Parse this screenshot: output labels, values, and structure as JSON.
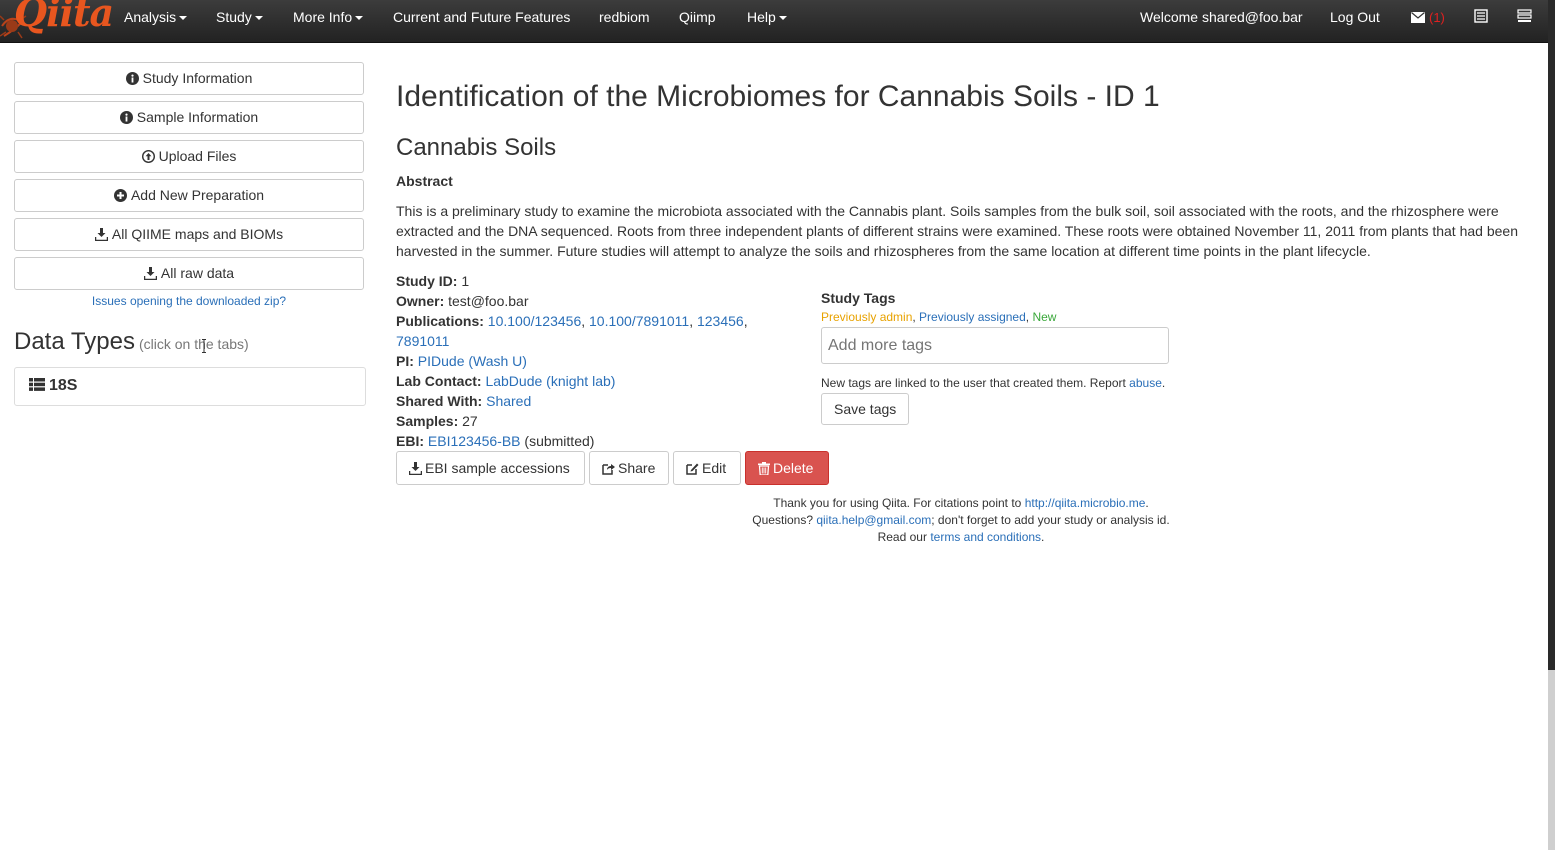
{
  "nav": {
    "items": [
      {
        "label": "Analysis",
        "dropdown": true
      },
      {
        "label": "Study",
        "dropdown": true
      },
      {
        "label": "More Info",
        "dropdown": true
      },
      {
        "label": "Current and Future Features",
        "dropdown": false
      },
      {
        "label": "redbiom",
        "dropdown": false
      },
      {
        "label": "Qiimp",
        "dropdown": false
      },
      {
        "label": "Help",
        "dropdown": true
      }
    ],
    "welcome": "Welcome shared@foo.bar",
    "logout": "Log Out",
    "mail_count": "(1)",
    "logo_text": "Qiita"
  },
  "sidebar": {
    "buttons": [
      {
        "label": "Study Information",
        "icon": "info-circle-icon"
      },
      {
        "label": "Sample Information",
        "icon": "info-circle-icon"
      },
      {
        "label": "Upload Files",
        "icon": "upload-circle-icon"
      },
      {
        "label": "Add New Preparation",
        "icon": "plus-circle-icon"
      },
      {
        "label": "All QIIME maps and BIOMs",
        "icon": "download-icon"
      },
      {
        "label": "All raw data",
        "icon": "download-icon"
      }
    ],
    "issues_link": "Issues opening the downloaded zip?",
    "data_types_title": "Data Types",
    "data_types_hint": "(click on the tabs)",
    "data_type_tab": "18S"
  },
  "study": {
    "title": "Identification of the Microbiomes for Cannabis Soils - ID 1",
    "alias": "Cannabis Soils",
    "abstract_label": "Abstract",
    "abstract": "This is a preliminary study to examine the microbiota associated with the Cannabis plant. Soils samples from the bulk soil, soil associated with the roots, and the rhizosphere were extracted and the DNA sequenced. Roots from three independent plants of different strains were examined. These roots were obtained November 11, 2011 from plants that had been harvested in the summer. Future studies will attempt to analyze the soils and rhizospheres from the same location at different time points in the plant lifecycle.",
    "id_label": "Study ID:",
    "id_value": "1",
    "owner_label": "Owner:",
    "owner_value": "test@foo.bar",
    "pubs_label": "Publications:",
    "pubs": [
      "10.100/123456",
      "10.100/7891011",
      "123456",
      "7891011"
    ],
    "pi_label": "PI:",
    "pi_value": "PIDude (Wash U)",
    "lab_label": "Lab Contact:",
    "lab_value": "LabDude (knight lab)",
    "shared_label": "Shared With:",
    "shared_value": "Shared",
    "samples_label": "Samples:",
    "samples_value": "27",
    "ebi_label": "EBI:",
    "ebi_value": "EBI123456-BB",
    "ebi_status": "(submitted)"
  },
  "tags": {
    "title": "Study Tags",
    "legend_admin": "Previously admin",
    "legend_assigned": "Previously assigned",
    "legend_new": "New",
    "placeholder": "Add more tags",
    "note_prefix": "New tags are linked to the user that created them. Report",
    "note_link": "abuse",
    "save_label": "Save tags"
  },
  "actions": {
    "ebi": "EBI sample accessions",
    "share": "Share",
    "edit": "Edit",
    "delete": "Delete"
  },
  "footer": {
    "line1_prefix": "Thank you for using Qiita. For citations point to",
    "line1_link": "http://qiita.microbio.me",
    "line2_prefix": "Questions?",
    "line2_link": "qiita.help@gmail.com",
    "line2_suffix": "; don't forget to add your study or analysis id.",
    "line3_prefix": "Read our",
    "line3_link": "terms and conditions"
  },
  "colors": {
    "navbar": "#2b2b2b",
    "link": "#2a6fb8",
    "danger": "#d9534f",
    "logo": "#e8561f"
  }
}
